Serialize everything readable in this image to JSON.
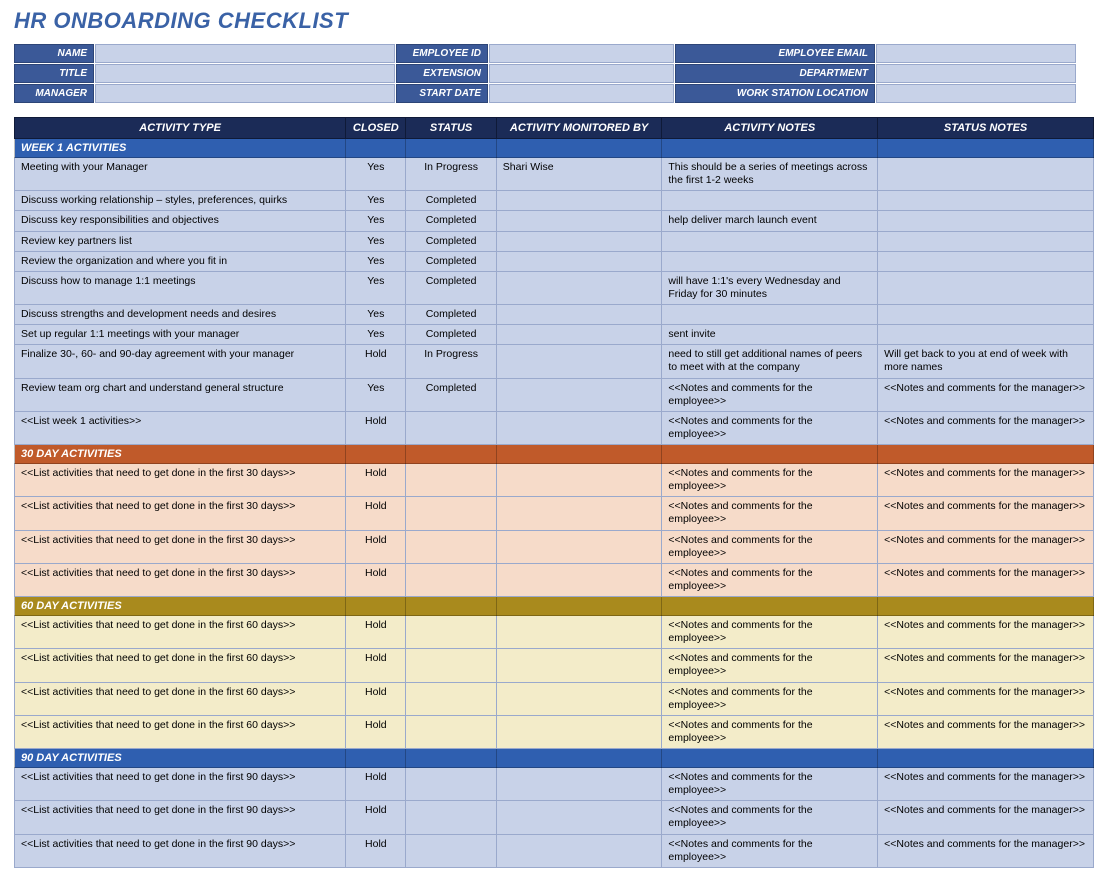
{
  "title": "HR ONBOARDING CHECKLIST",
  "info_fields": [
    [
      {
        "label": "NAME",
        "value": ""
      },
      {
        "label": "EMPLOYEE ID",
        "value": ""
      },
      {
        "label": "EMPLOYEE EMAIL",
        "value": ""
      }
    ],
    [
      {
        "label": "TITLE",
        "value": ""
      },
      {
        "label": "EXTENSION",
        "value": ""
      },
      {
        "label": "DEPARTMENT",
        "value": ""
      }
    ],
    [
      {
        "label": "MANAGER",
        "value": ""
      },
      {
        "label": "START DATE",
        "value": ""
      },
      {
        "label": "WORK STATION LOCATION",
        "value": ""
      }
    ]
  ],
  "columns": {
    "activity": "ACTIVITY TYPE",
    "closed": "CLOSED",
    "status": "STATUS",
    "monitor": "ACTIVITY MONITORED BY",
    "notes1": "ACTIVITY NOTES",
    "notes2": "STATUS NOTES"
  },
  "sections": [
    {
      "title": "WEEK 1 ACTIVITIES",
      "style": "blue1",
      "row_style": "blue",
      "rows": [
        {
          "activity": "Meeting with your Manager",
          "closed": "Yes",
          "status": "In Progress",
          "monitor": "Shari Wise",
          "notes1": "This should be a series of meetings across the first 1-2 weeks",
          "notes2": ""
        },
        {
          "activity": "Discuss working relationship – styles, preferences, quirks",
          "closed": "Yes",
          "status": "Completed",
          "monitor": "",
          "notes1": "",
          "notes2": ""
        },
        {
          "activity": "Discuss key responsibilities and objectives",
          "closed": "Yes",
          "status": "Completed",
          "monitor": "",
          "notes1": "help deliver march launch event",
          "notes2": ""
        },
        {
          "activity": "Review key partners list",
          "closed": "Yes",
          "status": "Completed",
          "monitor": "",
          "notes1": "",
          "notes2": ""
        },
        {
          "activity": "Review the organization and where you fit in",
          "closed": "Yes",
          "status": "Completed",
          "monitor": "",
          "notes1": "",
          "notes2": ""
        },
        {
          "activity": "Discuss how to manage 1:1 meetings",
          "closed": "Yes",
          "status": "Completed",
          "monitor": "",
          "notes1": "will have 1:1's every Wednesday and Friday for 30 minutes",
          "notes2": ""
        },
        {
          "activity": "Discuss strengths and development needs and desires",
          "closed": "Yes",
          "status": "Completed",
          "monitor": "",
          "notes1": "",
          "notes2": ""
        },
        {
          "activity": "Set up regular 1:1 meetings with your manager",
          "closed": "Yes",
          "status": "Completed",
          "monitor": "",
          "notes1": "sent invite",
          "notes2": ""
        },
        {
          "activity": "Finalize 30-, 60- and 90-day agreement with your manager",
          "closed": "Hold",
          "status": "In Progress",
          "monitor": "",
          "notes1": "need to still get additional names of peers to meet with at the company",
          "notes2": "Will get back to you at end of week with more names"
        },
        {
          "activity": "Review team org chart and understand general structure",
          "closed": "Yes",
          "status": "Completed",
          "monitor": "",
          "notes1": "<<Notes and comments for the employee>>",
          "notes2": "<<Notes and comments for the manager>>"
        },
        {
          "activity": "<<List week 1 activities>>",
          "closed": "Hold",
          "status": "",
          "monitor": "",
          "notes1": "<<Notes and comments for the employee>>",
          "notes2": "<<Notes and comments for the manager>>"
        }
      ]
    },
    {
      "title": "30 DAY ACTIVITIES",
      "style": "orange",
      "row_style": "orange",
      "rows": [
        {
          "activity": "<<List activities that need to get done in the first 30 days>>",
          "closed": "Hold",
          "status": "",
          "monitor": "",
          "notes1": "<<Notes and comments for the employee>>",
          "notes2": "<<Notes and comments for the manager>>"
        },
        {
          "activity": "<<List activities that need to get done in the first 30 days>>",
          "closed": "Hold",
          "status": "",
          "monitor": "",
          "notes1": "<<Notes and comments for the employee>>",
          "notes2": "<<Notes and comments for the manager>>"
        },
        {
          "activity": "<<List activities that need to get done in the first 30 days>>",
          "closed": "Hold",
          "status": "",
          "monitor": "",
          "notes1": "<<Notes and comments for the employee>>",
          "notes2": "<<Notes and comments for the manager>>"
        },
        {
          "activity": "<<List activities that need to get done in the first 30 days>>",
          "closed": "Hold",
          "status": "",
          "monitor": "",
          "notes1": "<<Notes and comments for the employee>>",
          "notes2": "<<Notes and comments for the manager>>"
        }
      ]
    },
    {
      "title": "60 DAY ACTIVITIES",
      "style": "olive",
      "row_style": "olive",
      "rows": [
        {
          "activity": "<<List activities that need to get done in the first 60 days>>",
          "closed": "Hold",
          "status": "",
          "monitor": "",
          "notes1": "<<Notes and comments for the employee>>",
          "notes2": "<<Notes and comments for the manager>>"
        },
        {
          "activity": "<<List activities that need to get done in the first 60 days>>",
          "closed": "Hold",
          "status": "",
          "monitor": "",
          "notes1": "<<Notes and comments for the employee>>",
          "notes2": "<<Notes and comments for the manager>>"
        },
        {
          "activity": "<<List activities that need to get done in the first 60 days>>",
          "closed": "Hold",
          "status": "",
          "monitor": "",
          "notes1": "<<Notes and comments for the employee>>",
          "notes2": "<<Notes and comments for the manager>>"
        },
        {
          "activity": "<<List activities that need to get done in the first 60 days>>",
          "closed": "Hold",
          "status": "",
          "monitor": "",
          "notes1": "<<Notes and comments for the employee>>",
          "notes2": "<<Notes and comments for the manager>>"
        }
      ]
    },
    {
      "title": "90 DAY ACTIVITIES",
      "style": "blue2",
      "row_style": "blue2",
      "rows": [
        {
          "activity": "<<List activities that need to get done in the first 90 days>>",
          "closed": "Hold",
          "status": "",
          "monitor": "",
          "notes1": "<<Notes and comments for the employee>>",
          "notes2": "<<Notes and comments for the manager>>"
        },
        {
          "activity": "<<List activities that need to get done in the first 90 days>>",
          "closed": "Hold",
          "status": "",
          "monitor": "",
          "notes1": "<<Notes and comments for the employee>>",
          "notes2": "<<Notes and comments for the manager>>"
        },
        {
          "activity": "<<List activities that need to get done in the first 90 days>>",
          "closed": "Hold",
          "status": "",
          "monitor": "",
          "notes1": "<<Notes and comments for the employee>>",
          "notes2": "<<Notes and comments for the manager>>"
        }
      ]
    }
  ]
}
